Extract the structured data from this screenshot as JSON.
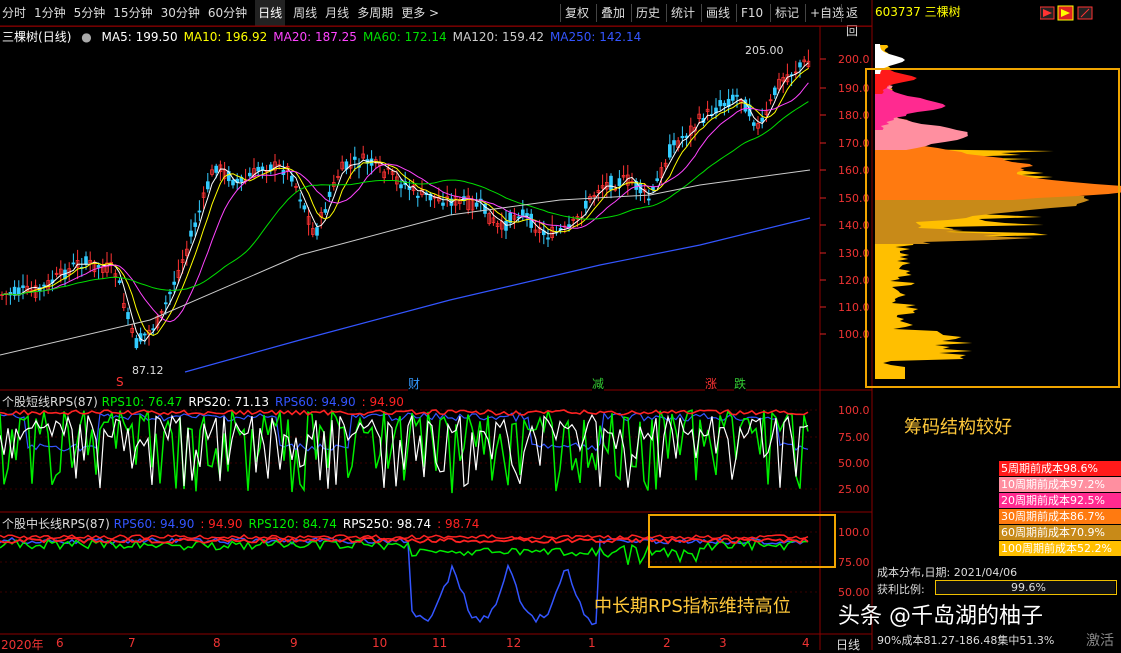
{
  "toolbar": {
    "periods": [
      "分时",
      "1分钟",
      "5分钟",
      "15分钟",
      "30分钟",
      "60分钟",
      "日线",
      "周线",
      "月线",
      "多周期",
      "更多 >"
    ],
    "active_period": "日线",
    "actions": [
      "复权",
      "叠加",
      "历史",
      "统计",
      "画线",
      "F10",
      "标记",
      "+自选",
      "返回"
    ]
  },
  "stock": {
    "header": "603737 三棵树",
    "name": "三棵树",
    "period": "(日线)"
  },
  "ma_legend": [
    {
      "label": "MA5: 199.50",
      "color": "#ffffff"
    },
    {
      "label": "MA10: 196.92",
      "color": "#ffff00"
    },
    {
      "label": "MA20: 187.25",
      "color": "#ff44ff"
    },
    {
      "label": "MA60: 172.14",
      "color": "#00dd00"
    },
    {
      "label": "MA120: 159.42",
      "color": "#cccccc"
    },
    {
      "label": "MA250: 142.14",
      "color": "#3355ff"
    }
  ],
  "price_axis": [
    "200.0",
    "190.0",
    "180.0",
    "170.0",
    "160.0",
    "150.0",
    "140.0",
    "130.0",
    "120.0",
    "110.0",
    "100.0"
  ],
  "price_marks": {
    "high": "205.00",
    "low": "87.12"
  },
  "event_marks": [
    {
      "label": "S",
      "color": "#ff3333"
    },
    {
      "label": "财",
      "color": "#3399ff"
    },
    {
      "label": "减",
      "color": "#33cc33"
    },
    {
      "label": "涨",
      "color": "#ff3333"
    },
    {
      "label": "跌",
      "color": "#33cc33"
    }
  ],
  "rps_short": {
    "title": "个股短线RPS(87)",
    "items": [
      {
        "label": "RPS10: 76.47",
        "color": "#00ee00"
      },
      {
        "label": "RPS20: 71.13",
        "color": "#ffffff"
      },
      {
        "label": "RPS60: 94.90",
        "color": "#3355ff"
      },
      {
        "label": ": 94.90",
        "color": "#ff2222"
      }
    ],
    "axis": [
      "100.0",
      "75.00",
      "50.00",
      "25.00"
    ]
  },
  "rps_long": {
    "title": "个股中长线RPS(87)",
    "items": [
      {
        "label": "RPS60: 94.90",
        "color": "#3355ff"
      },
      {
        "label": ": 94.90",
        "color": "#ff2222"
      },
      {
        "label": "RPS120: 84.74",
        "color": "#00ee00"
      },
      {
        "label": "RPS250: 98.74",
        "color": "#ffffff"
      },
      {
        "label": ": 98.74",
        "color": "#ff2222"
      }
    ],
    "axis": [
      "100.0",
      "75.00",
      "50.00"
    ]
  },
  "time_axis": [
    "2020年",
    "6",
    "7",
    "8",
    "9",
    "10",
    "11",
    "12",
    "1",
    "2",
    "3",
    "4"
  ],
  "time_axis_right": "日线",
  "cost_table": [
    {
      "label": "5周期前成本98.6%",
      "bg": "#ff1a1a"
    },
    {
      "label": "10周期前成本97.2%",
      "bg": "#ff8fa0"
    },
    {
      "label": "20周期前成本92.5%",
      "bg": "#ff2a90"
    },
    {
      "label": "30周期前成本86.7%",
      "bg": "#ff7a10"
    },
    {
      "label": "60周期前成本70.9%",
      "bg": "#c88a18"
    },
    {
      "label": "100周期前成本52.2%",
      "bg": "#ffbf00"
    }
  ],
  "cost_info": {
    "date_line": "成本分布,日期: 2021/04/06",
    "profit_label": "获利比例:",
    "profit_value": "99.6%",
    "range_line": "90%成本81.27-186.48集中51.3%"
  },
  "annotations": {
    "chip": "筹码结构较好",
    "rps": "中长期RPS指标维持高位"
  },
  "watermark": {
    "text": "头条 @千岛湖的柚子",
    "corner": "激活"
  }
}
